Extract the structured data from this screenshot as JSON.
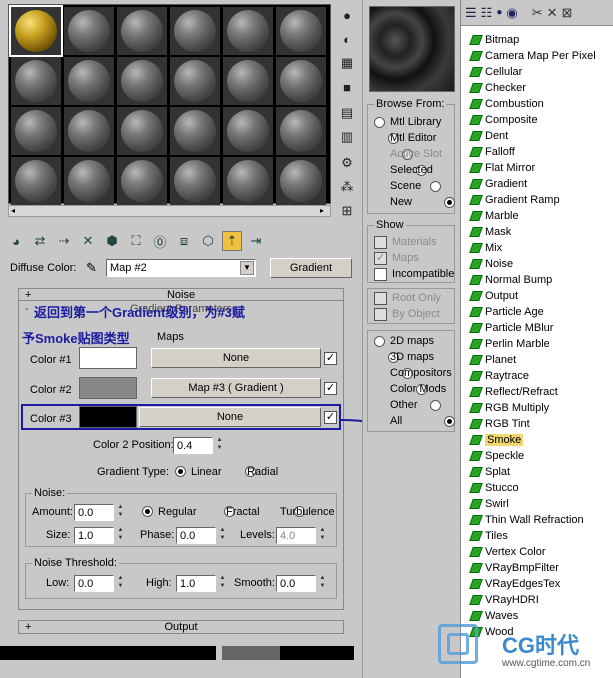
{
  "material_editor": {
    "diffuse_label": "Diffuse Color:",
    "map_dropdown": "Map #2",
    "type_button": "Gradient",
    "rollouts": {
      "noise": "Noise",
      "gradient_params": "Gradient Parameters",
      "maps": "Maps",
      "output": "Output"
    },
    "colors": [
      {
        "label": "Color #1",
        "swatch": "#ffffff",
        "map": "None",
        "checked": "✓"
      },
      {
        "label": "Color #2",
        "swatch": "#888888",
        "map": "Map #3  ( Gradient )",
        "checked": "✓"
      },
      {
        "label": "Color #3",
        "swatch": "#000000",
        "map": "None",
        "checked": "✓"
      }
    ],
    "color2_position_label": "Color 2 Position:",
    "color2_position_value": "0.4",
    "gradient_type_label": "Gradient Type:",
    "gradient_types": [
      "Linear",
      "Radial"
    ],
    "noise_group": "Noise:",
    "amount_label": "Amount:",
    "amount_value": "0.0",
    "noise_types": [
      "Regular",
      "Fractal",
      "Turbulence"
    ],
    "size_label": "Size:",
    "size_value": "1.0",
    "phase_label": "Phase:",
    "phase_value": "0.0",
    "levels_label": "Levels:",
    "levels_value": "4.0",
    "threshold_group": "Noise Threshold:",
    "low_label": "Low:",
    "low_value": "0.0",
    "high_label": "High:",
    "high_value": "1.0",
    "smooth_label": "Smooth:",
    "smooth_value": "0.0"
  },
  "annotation": {
    "line1": "返回到第一个Gradient级别，为#3赋",
    "line2": "予Smoke贴图类型"
  },
  "browser": {
    "browse_from_title": "Browse From:",
    "browse_from": [
      "Mtl Library",
      "Mtl Editor",
      "Active Slot",
      "Selected",
      "Scene",
      "New"
    ],
    "show_title": "Show",
    "show": [
      {
        "label": "Materials",
        "checked": ""
      },
      {
        "label": "Maps",
        "checked": "✓"
      },
      {
        "label": "Incompatible",
        "checked": ""
      }
    ],
    "root_only": "Root Only",
    "by_object": "By Object",
    "map_types": [
      "2D maps",
      "3D maps",
      "Compositors",
      "Color Mods",
      "Other",
      "All"
    ]
  },
  "map_list": [
    "Bitmap",
    "Camera Map Per Pixel",
    "Cellular",
    "Checker",
    "Combustion",
    "Composite",
    "Dent",
    "Falloff",
    "Flat Mirror",
    "Gradient",
    "Gradient Ramp",
    "Marble",
    "Mask",
    "Mix",
    "Noise",
    "Normal Bump",
    "Output",
    "Particle Age",
    "Particle MBlur",
    "Perlin Marble",
    "Planet",
    "Raytrace",
    "Reflect/Refract",
    "RGB Multiply",
    "RGB Tint",
    "Smoke",
    "Speckle",
    "Splat",
    "Stucco",
    "Swirl",
    "Thin Wall Refraction",
    "Tiles",
    "Vertex Color",
    "VRayBmpFilter",
    "VRayEdgesTex",
    "VRayHDRI",
    "Waves",
    "Wood"
  ],
  "watermark": {
    "brand": "CG时代",
    "url": "www.cgtime.com.cn"
  }
}
